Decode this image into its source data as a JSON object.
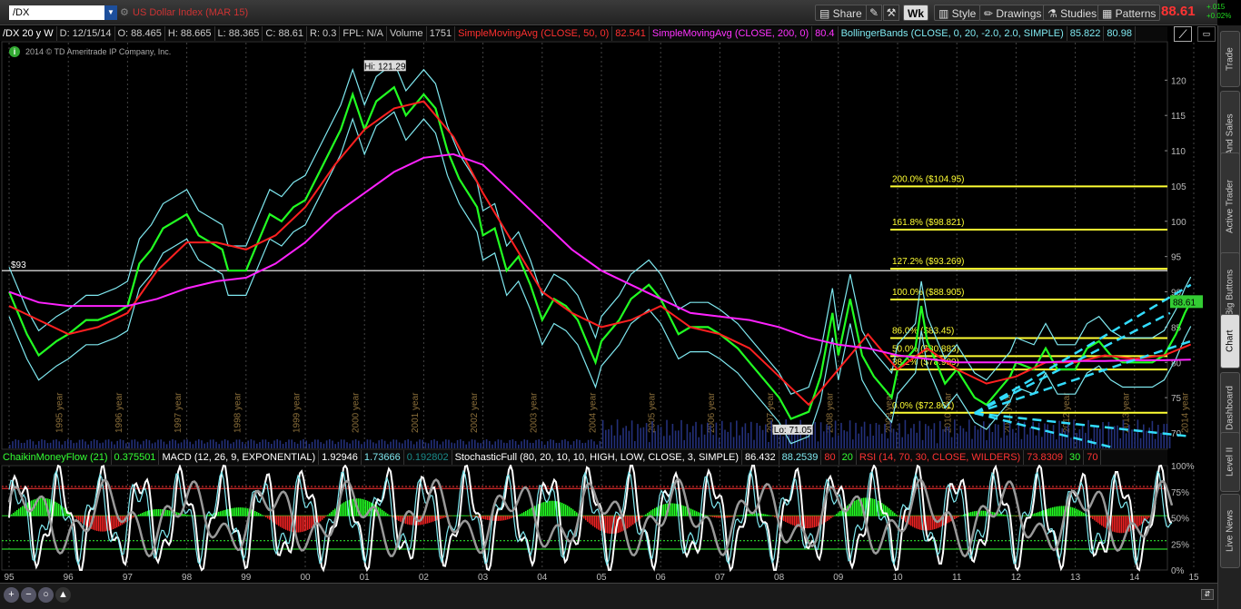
{
  "toolbar": {
    "symbol": "/DX",
    "description": "US Dollar Index (MAR 15)",
    "share": "Share",
    "wk": "Wk",
    "style": "Style",
    "drawings": "Drawings",
    "studies": "Studies",
    "patterns": "Patterns",
    "last": "88.61",
    "chg_abs": "+.015",
    "chg_pct": "+0.02%"
  },
  "infobar": {
    "period": "/DX 20 y W",
    "date": "D: 12/15/14",
    "open": "O: 88.465",
    "high": "H: 88.665",
    "low": "L: 88.365",
    "close": "C: 88.61",
    "range": "R: 0.3",
    "fpl": "FPL: N/A",
    "vol_label": "Volume",
    "vol": "1751",
    "sma50": "SimpleMovingAvg (CLOSE, 50, 0)",
    "sma50_val": "82.541",
    "sma200": "SimpleMovingAvg (CLOSE, 200, 0)",
    "sma200_val": "80.4",
    "bb": "BollingerBands (CLOSE, 0, 20, -2.0, 2.0, SIMPLE)",
    "bb_upper": "85.822",
    "bb_lower": "80.98"
  },
  "copyright": "2014 © TD Ameritrade IP Company, Inc.",
  "lower": {
    "cmf": "ChaikinMoneyFlow (21)",
    "cmf_val": "0.375501",
    "macd": "MACD (12, 26, 9, EXPONENTIAL)",
    "macd_v1": "1.92946",
    "macd_v2": "1.73666",
    "macd_v3": "0.192802",
    "stoch": "StochasticFull (80, 20, 10, 10, HIGH, LOW, CLOSE, 3, SIMPLE)",
    "stoch_v1": "86.432",
    "stoch_v2": "88.2539",
    "stoch_v3": "80",
    "stoch_v4": "20",
    "rsi": "RSI (14, 70, 30, CLOSE, WILDERS)",
    "rsi_v1": "73.8309",
    "rsi_v2": "30",
    "rsi_v3": "70"
  },
  "sidebar": [
    "Trade",
    "Times And Sales",
    "Active Trader",
    "Big Buttons",
    "Chart",
    "Dashboard",
    "Level II",
    "Live News"
  ],
  "bottom": {
    "zoom_in": "+",
    "zoom_out": "−",
    "reset": "○",
    "cursor": "▲"
  },
  "colors": {
    "price": "#22ff22",
    "sma50": "#ff2020",
    "sma200": "#ff22ff",
    "bb": "#7fe8f0",
    "fib": "#ffff33",
    "ref": "#ffffff",
    "last_bg": "#33cc33"
  },
  "chart_data": {
    "type": "line",
    "title": "US Dollar Index (MAR 15)",
    "ylim": [
      70,
      123
    ],
    "yticks": [
      70,
      75,
      80,
      85,
      90,
      95,
      100,
      105,
      110,
      115,
      120
    ],
    "year_ticks": [
      "95",
      "96",
      "97",
      "98",
      "99",
      "00",
      "01",
      "02",
      "03",
      "04",
      "05",
      "06",
      "07",
      "08",
      "09",
      "10",
      "11",
      "12",
      "13",
      "14",
      "15"
    ],
    "year_labels": [
      "1995 year",
      "1996 year",
      "1997 year",
      "1998 year",
      "1999 year",
      "2000 year",
      "2001 year",
      "2002 year",
      "2003 year",
      "2004 year",
      "2005 year",
      "2006 year",
      "2007 year",
      "2008 year",
      "2009 year",
      "2010 year",
      "2011 year",
      "2012 year",
      "2013 year",
      "2014 year"
    ],
    "series": [
      {
        "values": [
          [
            1995.0,
            90
          ],
          [
            1995.3,
            84
          ],
          [
            1995.5,
            81
          ],
          [
            1995.8,
            83
          ],
          [
            1996.0,
            84
          ],
          [
            1996.3,
            86
          ],
          [
            1996.5,
            86
          ],
          [
            1996.8,
            87
          ],
          [
            1997.0,
            88
          ],
          [
            1997.2,
            94
          ],
          [
            1997.4,
            96
          ],
          [
            1997.6,
            99
          ],
          [
            1997.8,
            100
          ],
          [
            1998.0,
            101
          ],
          [
            1998.2,
            98
          ],
          [
            1998.4,
            97
          ],
          [
            1998.6,
            96
          ],
          [
            1998.7,
            93
          ],
          [
            1999.0,
            93
          ],
          [
            1999.2,
            97
          ],
          [
            1999.4,
            101
          ],
          [
            1999.6,
            100
          ],
          [
            1999.8,
            102
          ],
          [
            2000.0,
            103
          ],
          [
            2000.3,
            108
          ],
          [
            2000.6,
            113
          ],
          [
            2000.8,
            118
          ],
          [
            2001.0,
            113
          ],
          [
            2001.2,
            117
          ],
          [
            2001.5,
            119
          ],
          [
            2001.7,
            115
          ],
          [
            2002.0,
            118
          ],
          [
            2002.2,
            116
          ],
          [
            2002.4,
            110
          ],
          [
            2002.6,
            106
          ],
          [
            2002.9,
            102
          ],
          [
            2003.0,
            98
          ],
          [
            2003.2,
            99
          ],
          [
            2003.4,
            93
          ],
          [
            2003.6,
            95
          ],
          [
            2003.8,
            91
          ],
          [
            2004.0,
            86
          ],
          [
            2004.2,
            89
          ],
          [
            2004.4,
            88
          ],
          [
            2004.6,
            86
          ],
          [
            2004.9,
            80
          ],
          [
            2005.0,
            83
          ],
          [
            2005.3,
            86
          ],
          [
            2005.5,
            89
          ],
          [
            2005.8,
            91
          ],
          [
            2006.0,
            89
          ],
          [
            2006.3,
            84
          ],
          [
            2006.5,
            85
          ],
          [
            2006.8,
            85
          ],
          [
            2007.0,
            84
          ],
          [
            2007.3,
            82
          ],
          [
            2007.5,
            80
          ],
          [
            2007.8,
            77
          ],
          [
            2008.0,
            75
          ],
          [
            2008.2,
            72
          ],
          [
            2008.5,
            73
          ],
          [
            2008.7,
            78
          ],
          [
            2008.9,
            87
          ],
          [
            2009.0,
            81
          ],
          [
            2009.2,
            89
          ],
          [
            2009.4,
            81
          ],
          [
            2009.6,
            78
          ],
          [
            2009.9,
            75
          ],
          [
            2010.0,
            79
          ],
          [
            2010.3,
            82
          ],
          [
            2010.4,
            88
          ],
          [
            2010.5,
            83
          ],
          [
            2010.8,
            77
          ],
          [
            2011.0,
            79
          ],
          [
            2011.3,
            75
          ],
          [
            2011.5,
            74
          ],
          [
            2011.7,
            76
          ],
          [
            2011.9,
            78
          ],
          [
            2012.0,
            80
          ],
          [
            2012.3,
            79
          ],
          [
            2012.5,
            82
          ],
          [
            2012.7,
            79
          ],
          [
            2013.0,
            79
          ],
          [
            2013.2,
            82
          ],
          [
            2013.4,
            83
          ],
          [
            2013.6,
            81
          ],
          [
            2013.8,
            80
          ],
          [
            2014.0,
            80
          ],
          [
            2014.3,
            80
          ],
          [
            2014.5,
            81
          ],
          [
            2014.7,
            84
          ],
          [
            2014.85,
            87
          ],
          [
            2014.95,
            88.61
          ]
        ]
      },
      {
        "name": "SimpleMovingAvg (CLOSE, 50, 0)",
        "values": [
          [
            1995.0,
            88
          ],
          [
            1995.5,
            86
          ],
          [
            1996.0,
            84
          ],
          [
            1996.5,
            85
          ],
          [
            1997.0,
            87
          ],
          [
            1997.5,
            93
          ],
          [
            1998.0,
            97
          ],
          [
            1998.5,
            97
          ],
          [
            1999.0,
            96
          ],
          [
            1999.5,
            98
          ],
          [
            2000.0,
            102
          ],
          [
            2000.5,
            108
          ],
          [
            2001.0,
            113
          ],
          [
            2001.5,
            116
          ],
          [
            2002.0,
            117
          ],
          [
            2002.5,
            112
          ],
          [
            2003.0,
            104
          ],
          [
            2003.5,
            97
          ],
          [
            2004.0,
            90
          ],
          [
            2004.5,
            87
          ],
          [
            2005.0,
            85
          ],
          [
            2005.5,
            86
          ],
          [
            2006.0,
            88
          ],
          [
            2006.5,
            85
          ],
          [
            2007.0,
            84
          ],
          [
            2007.5,
            82
          ],
          [
            2008.0,
            78
          ],
          [
            2008.5,
            74
          ],
          [
            2009.0,
            79
          ],
          [
            2009.5,
            84
          ],
          [
            2010.0,
            79
          ],
          [
            2010.5,
            82
          ],
          [
            2011.0,
            79
          ],
          [
            2011.5,
            77
          ],
          [
            2012.0,
            78
          ],
          [
            2012.5,
            80
          ],
          [
            2013.0,
            80
          ],
          [
            2013.5,
            81
          ],
          [
            2014.0,
            80.5
          ],
          [
            2014.5,
            81
          ],
          [
            2014.95,
            82.541
          ]
        ]
      },
      {
        "name": "SimpleMovingAvg (CLOSE, 200, 0)",
        "values": [
          [
            1995.0,
            90
          ],
          [
            1995.5,
            88.5
          ],
          [
            1996.0,
            88
          ],
          [
            1996.5,
            88
          ],
          [
            1997.0,
            88
          ],
          [
            1997.5,
            89
          ],
          [
            1998.0,
            90.5
          ],
          [
            1998.5,
            91.5
          ],
          [
            1999.0,
            92
          ],
          [
            1999.5,
            94
          ],
          [
            2000.0,
            97
          ],
          [
            2000.5,
            101
          ],
          [
            2001.0,
            104
          ],
          [
            2001.5,
            107
          ],
          [
            2002.0,
            109
          ],
          [
            2002.5,
            109.5
          ],
          [
            2003.0,
            108
          ],
          [
            2003.5,
            104
          ],
          [
            2004.0,
            100
          ],
          [
            2004.5,
            96
          ],
          [
            2005.0,
            93
          ],
          [
            2005.5,
            91
          ],
          [
            2006.0,
            89
          ],
          [
            2006.5,
            87
          ],
          [
            2007.0,
            86.5
          ],
          [
            2007.5,
            86
          ],
          [
            2008.0,
            85
          ],
          [
            2008.5,
            83.5
          ],
          [
            2009.0,
            82.5
          ],
          [
            2009.5,
            82
          ],
          [
            2010.0,
            81
          ],
          [
            2010.5,
            80.5
          ],
          [
            2011.0,
            80
          ],
          [
            2011.5,
            80
          ],
          [
            2012.0,
            80
          ],
          [
            2012.5,
            80
          ],
          [
            2013.0,
            80.2
          ],
          [
            2013.5,
            80.2
          ],
          [
            2014.0,
            80.3
          ],
          [
            2014.5,
            80.3
          ],
          [
            2014.95,
            80.4
          ]
        ]
      }
    ],
    "annotations": {
      "high": "Hi: 121.29",
      "low": "Lo: 71.05",
      "hline_label": "$93"
    },
    "fib_levels": [
      {
        "label": "200.0%  ($104.95)",
        "value": 104.95
      },
      {
        "label": "161.8%  ($98.821)",
        "value": 98.821
      },
      {
        "label": "127.2%  ($93.269)",
        "value": 93.269
      },
      {
        "label": "100.0%  ($88.905)",
        "value": 88.905
      },
      {
        "label": "86.0%  ($83.45)",
        "value": 83.45
      },
      {
        "label": "50.0%  ($80.883)",
        "value": 80.883
      },
      {
        "label": "38.2%  ($78.989)",
        "value": 78.989
      },
      {
        "label": "0.0%  ($72.861)",
        "value": 72.861
      }
    ],
    "osc_ticks": [
      "100%",
      "75%",
      "50%",
      "25%",
      "0%"
    ]
  }
}
